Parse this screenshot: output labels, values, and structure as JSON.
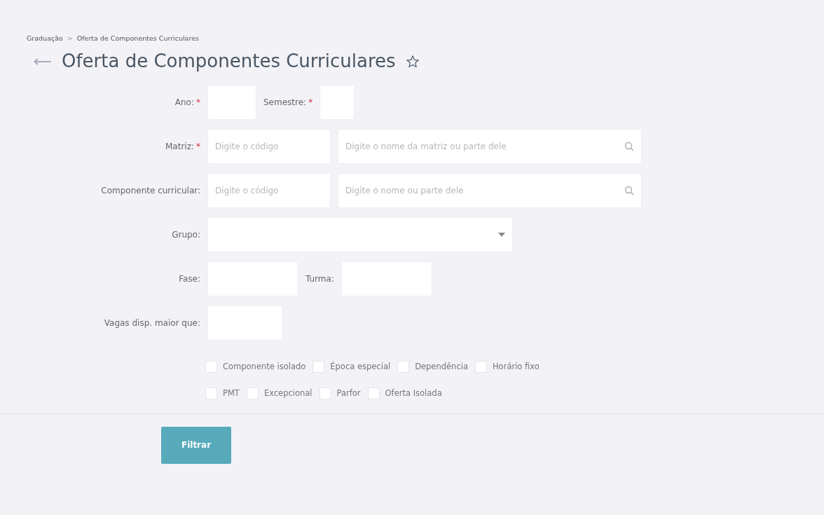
{
  "breadcrumb": [
    {
      "label": "Graduação"
    },
    {
      "label": ">",
      "kind": "separator"
    },
    {
      "label": "Oferta de Componentes Curriculares"
    }
  ],
  "title": "Oferta de Componentes Curriculares",
  "favorite": false,
  "rows": [
    {
      "items": [
        {
          "kind": "label",
          "text": "Ano:",
          "required_mark": "*"
        },
        {
          "kind": "input"
        },
        {
          "kind": "label",
          "text": "Semestre:",
          "required_mark": "*"
        },
        {
          "kind": "input"
        }
      ]
    },
    {
      "items": [
        {
          "kind": "label",
          "text": "Matriz:",
          "required_mark": "*"
        },
        {
          "kind": "input",
          "placeholder": "Digite o código"
        },
        {
          "kind": "search",
          "placeholder": "Digite o nome da matriz ou parte dele"
        }
      ]
    },
    {
      "items": [
        {
          "kind": "label",
          "text": "Componente curricular:"
        },
        {
          "kind": "input",
          "placeholder": "Digite o código"
        },
        {
          "kind": "search",
          "placeholder": "Digite o nome ou parte dele"
        }
      ]
    },
    {
      "items": [
        {
          "kind": "label",
          "text": "Grupo:"
        },
        {
          "kind": "select"
        }
      ]
    },
    {
      "items": [
        {
          "kind": "label",
          "text": "Fase:"
        },
        {
          "kind": "input"
        },
        {
          "kind": "label",
          "text": "Turma:"
        },
        {
          "kind": "input"
        }
      ]
    },
    {
      "items": [
        {
          "kind": "label",
          "text": "Vagas disp. maior que:"
        },
        {
          "kind": "input"
        }
      ]
    }
  ],
  "checkbox_rows": [
    [
      {
        "label": "Componente isolado",
        "checked": false
      },
      {
        "label": "Época especial",
        "checked": false
      },
      {
        "label": "Dependência",
        "checked": false
      },
      {
        "label": "Horário fixo",
        "checked": false
      }
    ],
    [
      {
        "label": "PMT",
        "checked": false
      },
      {
        "label": "Excepcional",
        "checked": false
      },
      {
        "label": "Parfor",
        "checked": false
      },
      {
        "label": "Oferta Isolada",
        "checked": false
      }
    ]
  ],
  "submit_button": "Filtrar"
}
